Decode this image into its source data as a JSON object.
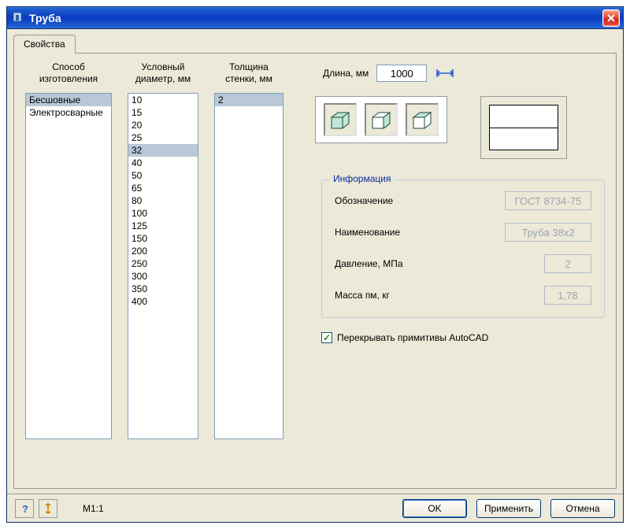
{
  "window": {
    "title": "Труба"
  },
  "tab": "Свойства",
  "cols": {
    "method": {
      "header": "Способ\nизготовления",
      "items": [
        "Бесшовные",
        "Электросварные"
      ],
      "selected": 0
    },
    "diameter": {
      "header": "Условный\nдиаметр, мм",
      "items": [
        "10",
        "15",
        "20",
        "25",
        "32",
        "40",
        "50",
        "65",
        "80",
        "100",
        "125",
        "150",
        "200",
        "250",
        "300",
        "350",
        "400"
      ],
      "selected": 4
    },
    "thickness": {
      "header": "Толщина\nстенки, мм",
      "items": [
        "2"
      ],
      "selected": 0
    }
  },
  "length": {
    "label": "Длина, мм",
    "value": "1000"
  },
  "info": {
    "legend": "Информация",
    "designation": {
      "label": "Обозначение",
      "value": "ГОСТ 8734-75"
    },
    "name": {
      "label": "Наименование",
      "value": "Труба 38x2"
    },
    "pressure": {
      "label": "Давление, МПа",
      "value": "2"
    },
    "mass": {
      "label": "Масса пм, кг",
      "value": "1,78"
    }
  },
  "overlap": {
    "label": "Перекрывать примитивы AutoCAD",
    "checked": true
  },
  "status": {
    "scale": "M1:1"
  },
  "buttons": {
    "ok": "OK",
    "apply": "Применить",
    "cancel": "Отмена"
  }
}
